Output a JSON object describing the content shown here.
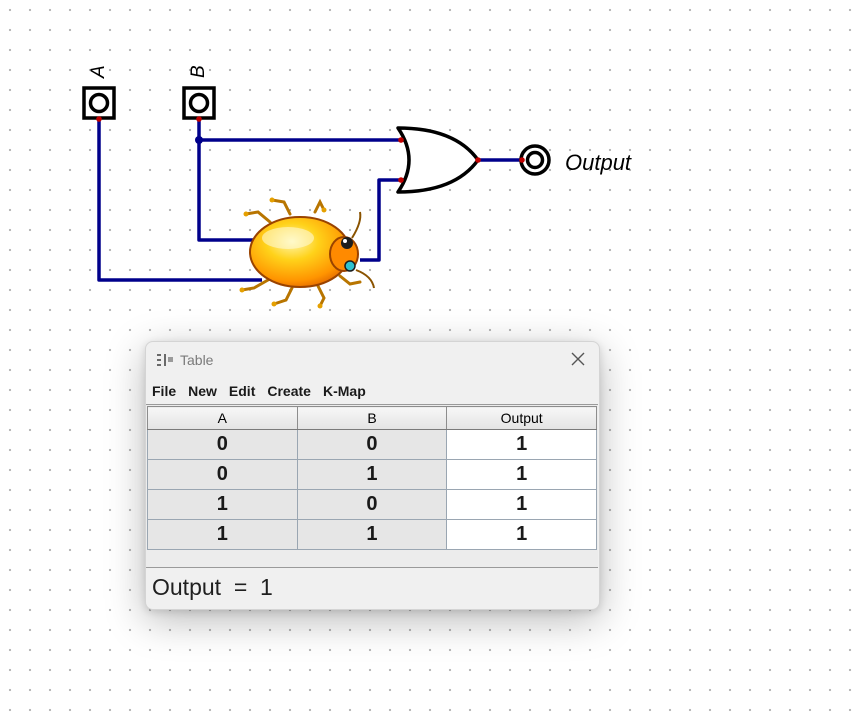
{
  "circuit": {
    "inputs": [
      {
        "label": "A"
      },
      {
        "label": "B"
      }
    ],
    "output_label": "Output",
    "gate": "OR",
    "wire_color": "#00008b",
    "connection_color": "#c00000"
  },
  "window": {
    "title": "Table",
    "close_icon": "close-icon",
    "app_icon": "truth-table-icon",
    "menu": [
      "File",
      "New",
      "Edit",
      "Create",
      "K-Map"
    ],
    "table": {
      "headers": [
        "A",
        "B",
        "Output"
      ],
      "rows": [
        [
          "0",
          "0",
          "1"
        ],
        [
          "0",
          "1",
          "1"
        ],
        [
          "1",
          "0",
          "1"
        ],
        [
          "1",
          "1",
          "1"
        ]
      ]
    },
    "expression": "Output  =  1"
  }
}
